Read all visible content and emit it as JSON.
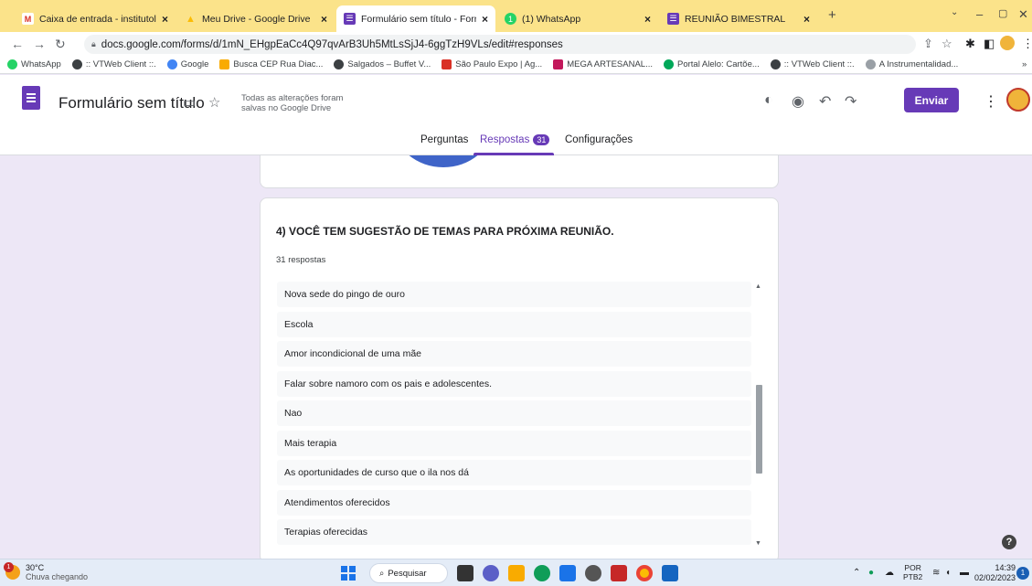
{
  "browser": {
    "tabs": [
      {
        "title": "Caixa de entrada - institutolucas",
        "icon": "gmail-icon",
        "color": "#d93025",
        "glyph": "M"
      },
      {
        "title": "Meu Drive - Google Drive",
        "icon": "drive-icon",
        "color": "#1e8e3e",
        "glyph": "▲"
      },
      {
        "title": "Formulário sem título - Formulári",
        "icon": "forms-icon",
        "color": "#673ab7",
        "glyph": "☰"
      },
      {
        "title": "(1) WhatsApp",
        "icon": "whatsapp-icon",
        "color": "#25d366",
        "glyph": "1"
      },
      {
        "title": "REUNIÃO BIMESTRAL",
        "icon": "forms-icon",
        "color": "#673ab7",
        "glyph": "☰"
      }
    ],
    "url": "docs.google.com/forms/d/1mN_EHgpEaCc4Q97qvArB3Uh5MtLsSjJ4-6ggTzH9VLs/edit#responses",
    "bookmarks": [
      {
        "label": "WhatsApp",
        "color": "#25d366"
      },
      {
        "label": ":: VTWeb Client ::.",
        "color": "#3c4043"
      },
      {
        "label": "Google",
        "color": "#4285f4"
      },
      {
        "label": "Busca CEP Rua Diac...",
        "color": "#f9ab00"
      },
      {
        "label": "Salgados – Buffet V...",
        "color": "#3c4043"
      },
      {
        "label": "São Paulo Expo | Ag...",
        "color": "#d93025"
      },
      {
        "label": "MEGA ARTESANAL...",
        "color": "#c2185b"
      },
      {
        "label": "Portal Alelo: Cartõe...",
        "color": "#00a859"
      },
      {
        "label": ":: VTWeb Client ::.",
        "color": "#3c4043"
      },
      {
        "label": "A Instrumentalidad...",
        "color": "#9aa0a6"
      }
    ],
    "bookmarks_more": "»"
  },
  "form": {
    "title": "Formulário sem título",
    "saved_line1": "Todas as alterações foram",
    "saved_line2": "salvas no Google Drive",
    "send_label": "Enviar",
    "tabs": {
      "questions": "Perguntas",
      "responses": "Respostas",
      "responses_count": "31",
      "settings": "Configurações"
    },
    "question": {
      "title": "4) VOCÊ TEM SUGESTÃO DE TEMAS PARA PRÓXIMA REUNIÃO.",
      "count": "31 respostas",
      "answers": [
        "Nova sede do pingo de ouro",
        "Escola",
        "Amor incondicional de uma mãe",
        "Falar sobre namoro com os pais e adolescentes.",
        "Nao",
        "Mais terapia",
        "As oportunidades de curso que o ila nos dá",
        "Atendimentos oferecidos",
        "Terapias oferecidas"
      ]
    },
    "help": "?"
  },
  "taskbar": {
    "temperature": "30°C",
    "weather": "Chuva chegando",
    "weather_badge": "1",
    "search": "Pesquisar",
    "lang1": "POR",
    "lang2": "PTB2",
    "time": "14:39",
    "date": "02/02/2023",
    "notif": "1"
  }
}
